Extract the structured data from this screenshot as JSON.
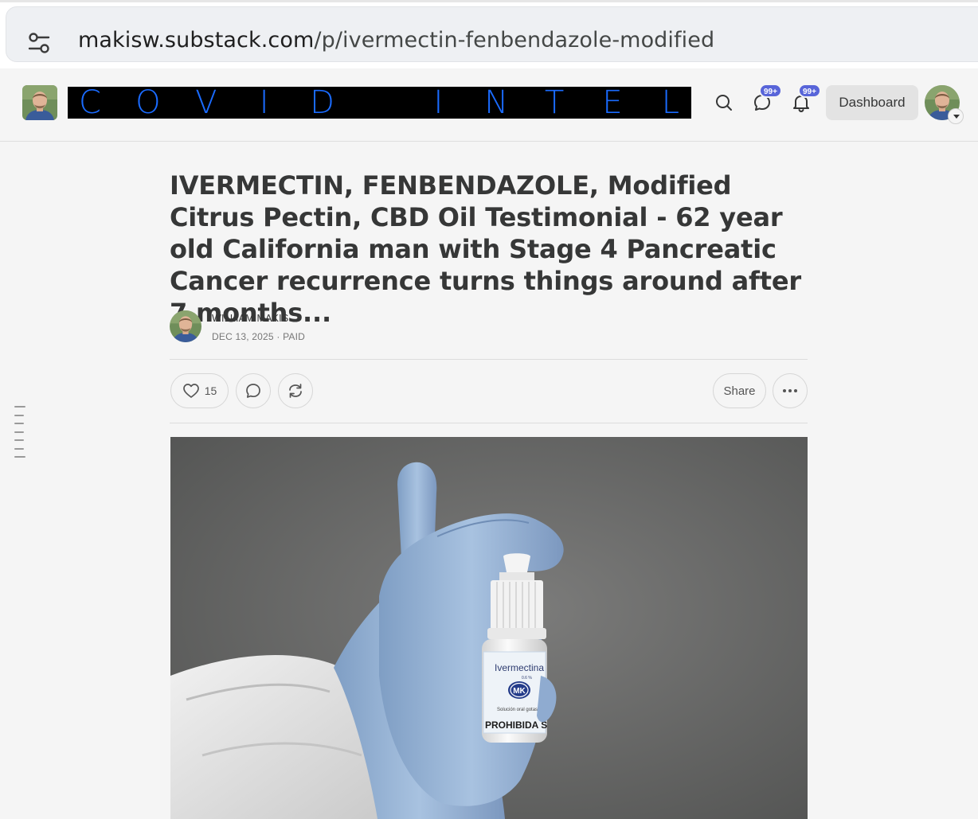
{
  "browser": {
    "url_host": "makisw.substack.com",
    "url_path": "/p/ivermectin-fenbendazole-modified"
  },
  "header": {
    "publication_wordmark": [
      "C",
      "O",
      "V",
      "I",
      "D",
      " ",
      "I",
      "N",
      "T",
      "E",
      "L"
    ],
    "chat_badge": "99+",
    "notifications_badge": "99+",
    "dashboard_label": "Dashboard",
    "wordmark_color": "#1a6bff",
    "badge_color": "#5865d9"
  },
  "post": {
    "title": "IVERMECTIN, FENBENDAZOLE, Modified Citrus Pectin, CBD Oil Testimonial - 62 year old California man with Stage 4 Pancreatic Cancer recurrence turns things around after 7 months...",
    "author": "WILLIAM MAKIS",
    "date": "DEC 13, 2025",
    "access": "PAID",
    "meta_separator": "·",
    "like_count": "15",
    "share_label": "Share"
  },
  "hero_image": {
    "bottle_label_name": "Ivermectina",
    "bottle_label_strength": "0.6 %",
    "bottle_label_brand": "MK",
    "bottle_label_form": "Solución oral gotas",
    "bottle_label_warning": "PROHIBIDA S"
  },
  "icons": {
    "site_settings": "site-settings-icon",
    "search": "search-icon",
    "chat": "chat-icon",
    "bell": "bell-icon",
    "heart": "heart-icon",
    "comment": "comment-icon",
    "restack": "restack-icon",
    "more": "more-icon"
  }
}
